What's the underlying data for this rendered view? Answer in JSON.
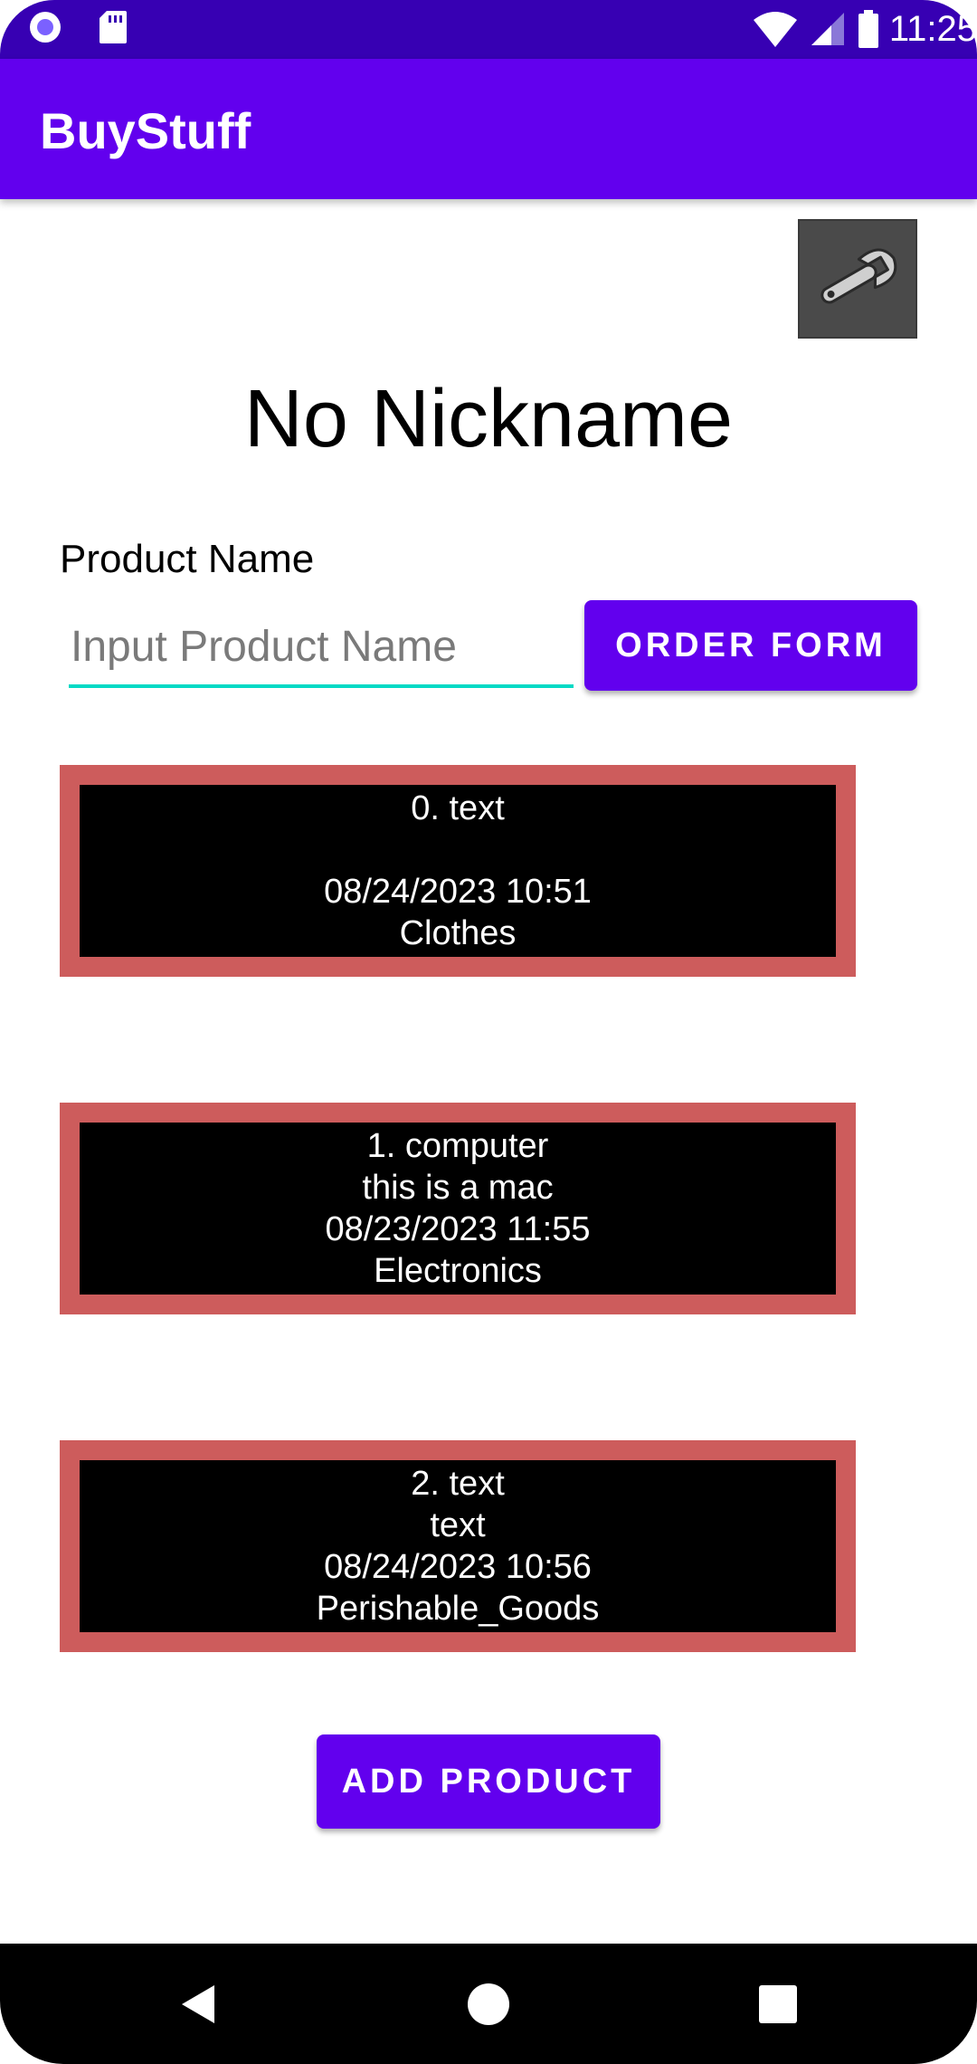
{
  "status_bar": {
    "time": "11:25",
    "left_icons": [
      "media-record-icon",
      "sd-card-icon"
    ],
    "right_icons": [
      "wifi-icon",
      "cell-signal-icon",
      "battery-icon"
    ]
  },
  "app_bar": {
    "title": "BuyStuff"
  },
  "settings": {
    "icon": "wrench-icon"
  },
  "nickname": "No Nickname",
  "product_form": {
    "label": "Product Name",
    "input_value": "",
    "input_placeholder": "Input Product Name",
    "order_button_label": "ORDER FORM"
  },
  "products": [
    {
      "title": "0. text",
      "description": "",
      "date": "08/24/2023 10:51",
      "category": "Clothes"
    },
    {
      "title": "1. computer",
      "description": "this is a mac",
      "date": "08/23/2023 11:55",
      "category": "Electronics"
    },
    {
      "title": "2. text",
      "description": "text",
      "date": "08/24/2023 10:56",
      "category": "Perishable_Goods"
    }
  ],
  "add_button_label": "ADD PRODUCT",
  "nav_bar": {
    "icons": [
      "back-icon",
      "home-icon",
      "recents-icon"
    ]
  },
  "colors": {
    "status_bar": "#3700b3",
    "app_bar": "#6200ee",
    "button": "#6200ee",
    "input_underline": "#03dac5",
    "card_border": "#cd5c5c",
    "card_fill": "#000000"
  }
}
